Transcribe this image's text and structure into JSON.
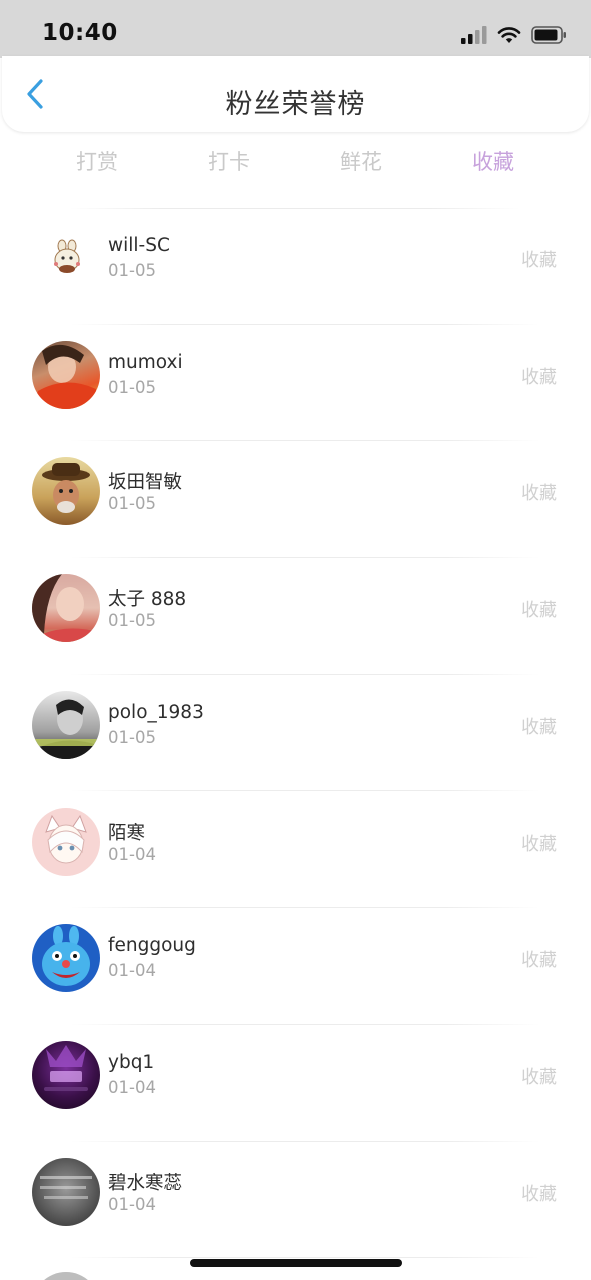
{
  "status_bar": {
    "time": "10:40"
  },
  "header": {
    "title": "粉丝荣誉榜"
  },
  "tabs": [
    {
      "label": "打赏",
      "active": false
    },
    {
      "label": "打卡",
      "active": false
    },
    {
      "label": "鲜花",
      "active": false
    },
    {
      "label": "收藏",
      "active": true
    }
  ],
  "fans": [
    {
      "name": "will-SC",
      "date": "01-05",
      "action": "收藏"
    },
    {
      "name": "mumoxi",
      "date": "01-05",
      "action": "收藏"
    },
    {
      "name": "坂田智敏",
      "date": "01-05",
      "action": "收藏"
    },
    {
      "name": "太子 888",
      "date": "01-05",
      "action": "收藏"
    },
    {
      "name": "polo_1983",
      "date": "01-05",
      "action": "收藏"
    },
    {
      "name": "陌寒",
      "date": "01-04",
      "action": "收藏"
    },
    {
      "name": "fenggoug",
      "date": "01-04",
      "action": "收藏"
    },
    {
      "name": "ybq1",
      "date": "01-04",
      "action": "收藏"
    },
    {
      "name": "碧水寒蕊",
      "date": "01-04",
      "action": "收藏"
    }
  ],
  "colors": {
    "accent": "#c7a2dc",
    "back_arrow": "#3a9fe0",
    "status_bar_bg": "#d8d8d8"
  }
}
